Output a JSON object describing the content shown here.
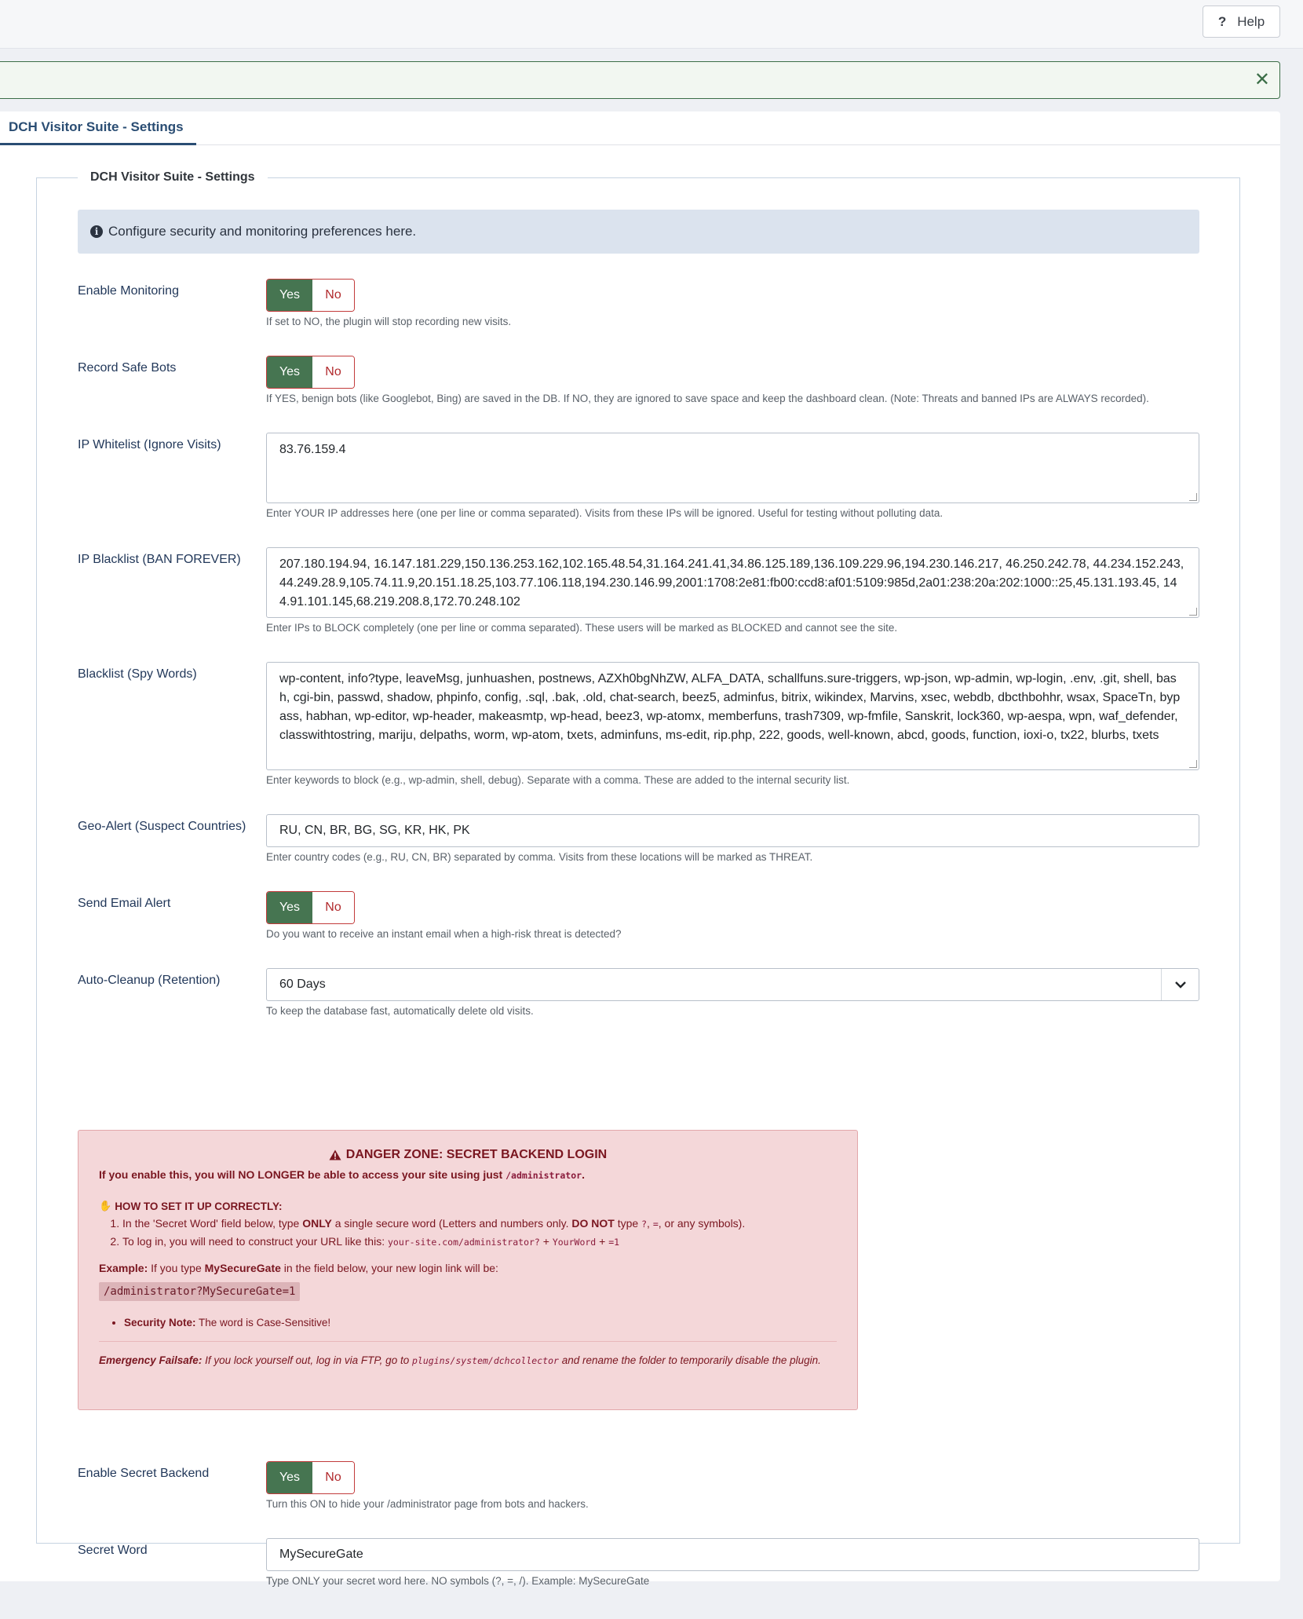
{
  "header": {
    "help_label": "Help",
    "help_icon": "question-icon"
  },
  "alert": {
    "close_icon": "close-icon"
  },
  "tabs": [
    {
      "label": "DCH Visitor Suite - Settings",
      "active": true
    }
  ],
  "fieldset": {
    "legend": "DCH Visitor Suite - Settings"
  },
  "info": {
    "text": "Configure security and monitoring preferences here."
  },
  "fields": {
    "enable_monitoring": {
      "label": "Enable Monitoring",
      "yes": "Yes",
      "no": "No",
      "selected": "Yes",
      "hint": "If set to NO, the plugin will stop recording new visits."
    },
    "record_safe_bots": {
      "label": "Record Safe Bots",
      "yes": "Yes",
      "no": "No",
      "selected": "Yes",
      "hint": "If YES, benign bots (like Googlebot, Bing) are saved in the DB. If NO, they are ignored to save space and keep the dashboard clean. (Note: Threats and banned IPs are ALWAYS recorded)."
    },
    "ip_whitelist": {
      "label": "IP Whitelist (Ignore Visits)",
      "value": "83.76.159.4",
      "hint": "Enter YOUR IP addresses here (one per line or comma separated). Visits from these IPs will be ignored. Useful for testing without polluting data."
    },
    "ip_blacklist": {
      "label": "IP Blacklist (BAN FOREVER)",
      "value": "207.180.194.94, 16.147.181.229,150.136.253.162,102.165.48.54,31.164.241.41,34.86.125.189,136.109.229.96,194.230.146.217, 46.250.242.78, 44.234.152.243,44.249.28.9,105.74.11.9,20.151.18.25,103.77.106.118,194.230.146.99,2001:1708:2e81:fb00:ccd8:af01:5109:985d,2a01:238:20a:202:1000::25,45.131.193.45, 144.91.101.145,68.219.208.8,172.70.248.102",
      "hint": "Enter IPs to BLOCK completely (one per line or comma separated). These users will be marked as BLOCKED and cannot see the site."
    },
    "blacklist_words": {
      "label": "Blacklist (Spy Words)",
      "value": "wp-content, info?type, leaveMsg, junhuashen, postnews, AZXh0bgNhZW, ALFA_DATA, schallfuns.sure-triggers, wp-json, wp-admin, wp-login, .env, .git, shell, bash, cgi-bin, passwd, shadow, phpinfo, config, .sql, .bak, .old, chat-search, beez5, adminfus, bitrix, wikindex, Marvins, xsec, webdb, dbcthbohhr, wsax, SpaceTn, bypass, habhan, wp-editor, wp-header, makeasmtp, wp-head, beez3, wp-atomx, memberfuns, trash7309, wp-fmfile, Sanskrit, lock360, wp-aespa, wpn, waf_defender, classwithtostring, mariju, delpaths, worm, wp-atom, txets, adminfuns, ms-edit, rip.php, 222, goods, well-known, abcd, goods, function, ioxi-o, tx22, blurbs, txets",
      "hint": "Enter keywords to block (e.g., wp-admin, shell, debug). Separate with a comma. These are added to the internal security list."
    },
    "geo_alert": {
      "label": "Geo-Alert (Suspect Countries)",
      "value": "RU, CN, BR, BG, SG, KR, HK, PK",
      "hint": "Enter country codes (e.g., RU, CN, BR) separated by comma. Visits from these locations will be marked as THREAT."
    },
    "send_email_alert": {
      "label": "Send Email Alert",
      "yes": "Yes",
      "no": "No",
      "selected": "Yes",
      "hint": "Do you want to receive an instant email when a high-risk threat is detected?"
    },
    "auto_cleanup": {
      "label": "Auto-Cleanup (Retention)",
      "value": "60 Days",
      "hint": "To keep the database fast, automatically delete old visits."
    },
    "enable_secret_backend": {
      "label": "Enable Secret Backend",
      "yes": "Yes",
      "no": "No",
      "selected": "Yes",
      "hint": "Turn this ON to hide your /administrator page from bots and hackers."
    },
    "secret_word": {
      "label": "Secret Word",
      "value": "MySecureGate",
      "hint": "Type ONLY your secret word here. NO symbols (?, =, /). Example: MySecureGate"
    }
  },
  "danger": {
    "title": "DANGER ZONE: SECRET BACKEND LOGIN",
    "intro_prefix": "If you enable this, you will NO LONGER be able to access your site using just",
    "intro_code": "/administrator",
    "intro_suffix": ".",
    "howto": "HOW TO SET IT UP CORRECTLY:",
    "step1_a": "In the 'Secret Word' field below, type",
    "step1_b": "ONLY",
    "step1_c": "a single secure word (Letters and numbers only.",
    "step1_d": "DO NOT",
    "step1_e": "type",
    "step1_code1": "?",
    "step1_sep": ",",
    "step1_code2": "=",
    "step1_f": ", or any symbols).",
    "step2_a": "To log in, you will need to construct your URL like this:",
    "step2_code1": "your-site.com/administrator?",
    "step2_plus1": "+",
    "step2_code2": "YourWord",
    "step2_plus2": "+",
    "step2_code3": "=1",
    "example_label": "Example:",
    "example_a": "If you type",
    "example_word": "MySecureGate",
    "example_b": "in the field below, your new login link will be:",
    "example_code": "/administrator?MySecureGate=1",
    "note_label": "Security Note:",
    "note_text": "The word is Case-Sensitive!",
    "failsafe_label": "Emergency Failsafe:",
    "failsafe_a": "If you lock yourself out, log in via FTP, go to",
    "failsafe_code": "plugins/system/dchcollector",
    "failsafe_b": "and rename the folder to temporarily disable the plugin."
  }
}
